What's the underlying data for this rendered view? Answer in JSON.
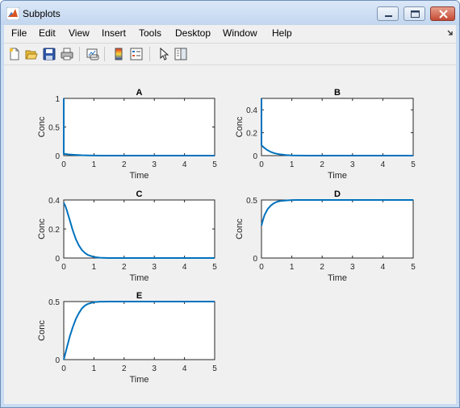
{
  "window": {
    "title": "Subplots",
    "buttons": {
      "minimize": "minimize-icon",
      "maximize": "maximize-icon",
      "close": "close-icon"
    }
  },
  "menu": {
    "items": [
      "File",
      "Edit",
      "View",
      "Insert",
      "Tools",
      "Desktop",
      "Window",
      "Help"
    ]
  },
  "toolbar": {
    "icons": [
      "new-figure-icon",
      "open-icon",
      "save-icon",
      "print-icon",
      "link-plot-icon",
      "colorbar-icon",
      "legend-icon",
      "edit-plot-icon",
      "property-editor-icon"
    ]
  },
  "colors": {
    "line": "#0072bd",
    "axes_bg": "#ffffff",
    "figure_bg": "#f0f0f0"
  },
  "chart_data": [
    {
      "type": "line",
      "title": "A",
      "xlabel": "Time",
      "ylabel": "Conc",
      "xlim": [
        0,
        5
      ],
      "ylim": [
        0,
        1
      ],
      "xticks": [
        "0",
        "1",
        "2",
        "3",
        "4",
        "5"
      ],
      "yticks": [
        "0",
        "0.5",
        "1"
      ],
      "x": [
        0,
        0.001,
        0.05,
        0.1,
        0.2,
        0.4,
        0.6,
        0.8,
        1.0,
        1.5,
        2,
        3,
        4,
        5
      ],
      "y": [
        1,
        0.03,
        0.028,
        0.025,
        0.02,
        0.012,
        0.007,
        0.004,
        0.002,
        0.0005,
        0,
        0,
        0,
        0
      ]
    },
    {
      "type": "line",
      "title": "B",
      "xlabel": "Time",
      "ylabel": "Conc",
      "xlim": [
        0,
        5
      ],
      "ylim": [
        0,
        0.5
      ],
      "xticks": [
        "0",
        "1",
        "2",
        "3",
        "4",
        "5"
      ],
      "yticks": [
        "0",
        "0.2",
        "0.4"
      ],
      "x": [
        0,
        0.001,
        0.05,
        0.1,
        0.2,
        0.3,
        0.4,
        0.5,
        0.6,
        0.8,
        1.0,
        1.5,
        2,
        3,
        4,
        5
      ],
      "y": [
        0.5,
        0.09,
        0.078,
        0.066,
        0.047,
        0.033,
        0.023,
        0.016,
        0.011,
        0.005,
        0.002,
        0.0003,
        0,
        0,
        0,
        0
      ]
    },
    {
      "type": "line",
      "title": "C",
      "xlabel": "Time",
      "ylabel": "Conc",
      "xlim": [
        0,
        5
      ],
      "ylim": [
        0,
        0.4
      ],
      "xticks": [
        "0",
        "1",
        "2",
        "3",
        "4",
        "5"
      ],
      "yticks": [
        "0",
        "0.2",
        "0.4"
      ],
      "x": [
        0,
        0.05,
        0.1,
        0.2,
        0.3,
        0.4,
        0.5,
        0.6,
        0.7,
        0.8,
        1.0,
        1.2,
        1.5,
        2,
        3,
        4,
        5
      ],
      "y": [
        0.38,
        0.36,
        0.33,
        0.26,
        0.19,
        0.13,
        0.087,
        0.056,
        0.035,
        0.021,
        0.007,
        0.002,
        0,
        0,
        0,
        0,
        0
      ]
    },
    {
      "type": "line",
      "title": "D",
      "xlabel": "Time",
      "ylabel": "Conc",
      "xlim": [
        0,
        5
      ],
      "ylim": [
        0,
        0.5
      ],
      "xticks": [
        "0",
        "1",
        "2",
        "3",
        "4",
        "5"
      ],
      "yticks": [
        "0",
        "0.5"
      ],
      "x": [
        0,
        0.05,
        0.1,
        0.2,
        0.3,
        0.4,
        0.5,
        0.6,
        0.8,
        1.0,
        1.2,
        1.5,
        2,
        3,
        4,
        5
      ],
      "y": [
        0.28,
        0.33,
        0.37,
        0.42,
        0.45,
        0.47,
        0.483,
        0.49,
        0.496,
        0.499,
        0.5,
        0.5,
        0.5,
        0.5,
        0.5,
        0.5
      ]
    },
    {
      "type": "line",
      "title": "E",
      "xlabel": "Time",
      "ylabel": "Conc",
      "xlim": [
        0,
        5
      ],
      "ylim": [
        0,
        0.5
      ],
      "xticks": [
        "0",
        "1",
        "2",
        "3",
        "4",
        "5"
      ],
      "yticks": [
        "0",
        "0.5"
      ],
      "x": [
        0,
        0.05,
        0.1,
        0.2,
        0.3,
        0.4,
        0.5,
        0.6,
        0.7,
        0.8,
        1.0,
        1.2,
        1.5,
        2,
        3,
        4,
        5
      ],
      "y": [
        0,
        0.05,
        0.1,
        0.2,
        0.28,
        0.35,
        0.4,
        0.44,
        0.465,
        0.48,
        0.495,
        0.499,
        0.5,
        0.5,
        0.5,
        0.5,
        0.5
      ]
    }
  ]
}
